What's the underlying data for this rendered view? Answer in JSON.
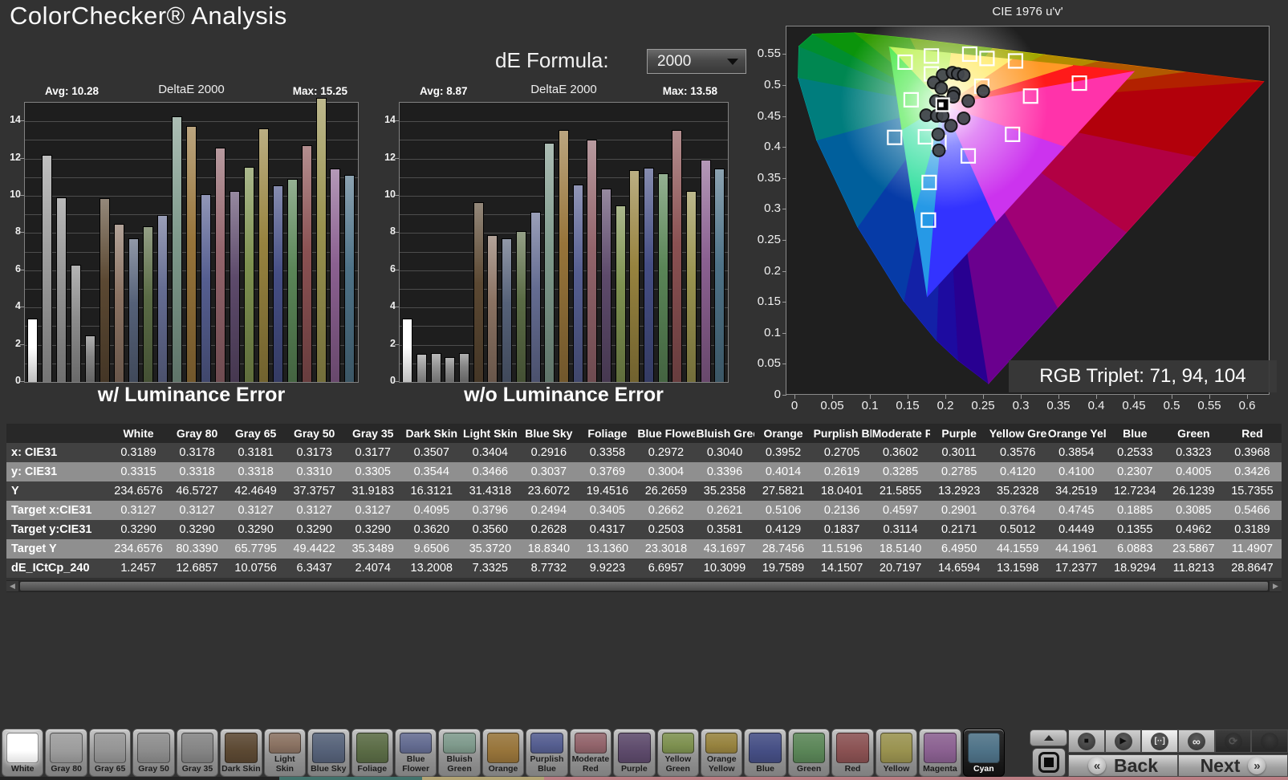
{
  "page": {
    "title": "ColorChecker® Analysis"
  },
  "de_formula": {
    "label": "dE Formula:",
    "value": "2000"
  },
  "chart_headers": {
    "left": {
      "avg": "Avg: 10.28",
      "formula": "DeltaE 2000",
      "max": "Max: 15.25",
      "caption": "w/ Luminance Error"
    },
    "right": {
      "avg": "Avg: 8.87",
      "formula": "DeltaE 2000",
      "max": "Max: 13.58",
      "caption": "w/o Luminance Error"
    }
  },
  "chart_data": [
    {
      "type": "bar",
      "title": "w/ Luminance Error",
      "subtitle": "DeltaE 2000",
      "avg": 10.28,
      "max": 15.25,
      "ylim": [
        0,
        15
      ],
      "yticks": [
        0,
        2,
        4,
        6,
        8,
        10,
        12,
        14
      ],
      "categories": [
        "White",
        "Gray 80",
        "Gray 65",
        "Gray 50",
        "Gray 35",
        "Dark Skin",
        "Light Skin",
        "Blue Sky",
        "Foliage",
        "Blue Flower",
        "Bluish Green",
        "Orange",
        "Purplish Blue",
        "Moderate Red",
        "Purple",
        "Yellow Green",
        "Orange Yellow",
        "Blue",
        "Green",
        "Red",
        "Yellow",
        "Magenta",
        "Cyan"
      ],
      "values": [
        3.4,
        12.2,
        9.9,
        6.3,
        2.5,
        9.85,
        8.5,
        7.7,
        8.35,
        8.95,
        14.25,
        13.75,
        10.1,
        12.6,
        10.25,
        11.55,
        13.6,
        10.55,
        10.9,
        12.7,
        15.25,
        11.45,
        11.1
      ]
    },
    {
      "type": "bar",
      "title": "w/o Luminance Error",
      "subtitle": "DeltaE 2000",
      "avg": 8.87,
      "max": 13.58,
      "ylim": [
        0,
        15
      ],
      "yticks": [
        0,
        2,
        4,
        6,
        8,
        10,
        12,
        14
      ],
      "categories": [
        "White",
        "Gray 80",
        "Gray 65",
        "Gray 50",
        "Gray 35",
        "Dark Skin",
        "Light Skin",
        "Blue Sky",
        "Foliage",
        "Blue Flower",
        "Bluish Green",
        "Orange",
        "Purplish Blue",
        "Moderate Red",
        "Purple",
        "Yellow Green",
        "Orange Yellow",
        "Blue",
        "Green",
        "Red",
        "Yellow",
        "Magenta",
        "Cyan"
      ],
      "values": [
        3.4,
        1.5,
        1.55,
        1.35,
        1.55,
        9.65,
        7.9,
        7.7,
        8.1,
        9.15,
        12.85,
        13.55,
        10.6,
        13.0,
        10.4,
        9.5,
        11.4,
        11.5,
        11.2,
        13.55,
        10.25,
        11.95,
        11.45
      ]
    },
    {
      "type": "scatter",
      "title": "CIE 1976 u'v'",
      "xlim": [
        0,
        0.63
      ],
      "ylim": [
        0,
        0.566
      ],
      "xticks": [
        "0",
        "0.05",
        "0.1",
        "0.15",
        "0.2",
        "0.25",
        "0.3",
        "0.35",
        "0.4",
        "0.45",
        "0.5",
        "0.55",
        "0.6"
      ],
      "yticks": [
        "0",
        "0.05",
        "0.1",
        "0.15",
        "0.2",
        "0.25",
        "0.3",
        "0.35",
        "0.4",
        "0.45",
        "0.5",
        "0.55"
      ],
      "annotation": "RGB Triplet: 71, 94, 104",
      "white_point": [
        0.196,
        0.469
      ],
      "series": [
        {
          "name": "reference-targets",
          "marker": "square",
          "points": [
            [
              0.146,
              0.538
            ],
            [
              0.181,
              0.548
            ],
            [
              0.232,
              0.551
            ],
            [
              0.255,
              0.544
            ],
            [
              0.293,
              0.54
            ],
            [
              0.378,
              0.504
            ],
            [
              0.248,
              0.499
            ],
            [
              0.313,
              0.483
            ],
            [
              0.154,
              0.477
            ],
            [
              0.181,
              0.519
            ],
            [
              0.132,
              0.416
            ],
            [
              0.173,
              0.417
            ],
            [
              0.191,
              0.408
            ],
            [
              0.289,
              0.421
            ],
            [
              0.23,
              0.386
            ],
            [
              0.178,
              0.343
            ],
            [
              0.177,
              0.282
            ]
          ]
        },
        {
          "name": "measured",
          "marker": "circle",
          "points": [
            [
              0.196,
              0.517
            ],
            [
              0.209,
              0.521
            ],
            [
              0.216,
              0.519
            ],
            [
              0.224,
              0.517
            ],
            [
              0.184,
              0.505
            ],
            [
              0.194,
              0.496
            ],
            [
              0.211,
              0.488
            ],
            [
              0.21,
              0.482
            ],
            [
              0.25,
              0.491
            ],
            [
              0.23,
              0.475
            ],
            [
              0.187,
              0.475
            ],
            [
              0.195,
              0.473
            ],
            [
              0.174,
              0.452
            ],
            [
              0.188,
              0.451
            ],
            [
              0.196,
              0.451
            ],
            [
              0.224,
              0.447
            ],
            [
              0.207,
              0.435
            ],
            [
              0.19,
              0.421
            ],
            [
              0.191,
              0.395
            ]
          ]
        }
      ]
    }
  ],
  "table": {
    "columns": [
      "White",
      "Gray 80",
      "Gray 65",
      "Gray 50",
      "Gray 35",
      "Dark Skin",
      "Light Skin",
      "Blue Sky",
      "Foliage",
      "Blue Flower",
      "Bluish Green",
      "Orange",
      "Purplish Blue",
      "Moderate Red",
      "Purple",
      "Yellow Green",
      "Orange Yellow",
      "Blue",
      "Green",
      "Red"
    ],
    "rows": [
      {
        "label": "x: CIE31",
        "values": [
          "0.3189",
          "0.3178",
          "0.3181",
          "0.3173",
          "0.3177",
          "0.3507",
          "0.3404",
          "0.2916",
          "0.3358",
          "0.2972",
          "0.3040",
          "0.3952",
          "0.2705",
          "0.3602",
          "0.3011",
          "0.3576",
          "0.3854",
          "0.2533",
          "0.3323",
          "0.3968"
        ]
      },
      {
        "label": "y: CIE31",
        "values": [
          "0.3315",
          "0.3318",
          "0.3318",
          "0.3310",
          "0.3305",
          "0.3544",
          "0.3466",
          "0.3037",
          "0.3769",
          "0.3004",
          "0.3396",
          "0.4014",
          "0.2619",
          "0.3285",
          "0.2785",
          "0.4120",
          "0.4100",
          "0.2307",
          "0.4005",
          "0.3426"
        ]
      },
      {
        "label": "Y",
        "values": [
          "234.6576",
          "46.5727",
          "42.4649",
          "37.3757",
          "31.9183",
          "16.3121",
          "31.4318",
          "23.6072",
          "19.4516",
          "26.2659",
          "35.2358",
          "27.5821",
          "18.0401",
          "21.5855",
          "13.2923",
          "35.2328",
          "34.2519",
          "12.7234",
          "26.1239",
          "15.7355"
        ]
      },
      {
        "label": "Target x:CIE31",
        "values": [
          "0.3127",
          "0.3127",
          "0.3127",
          "0.3127",
          "0.3127",
          "0.4095",
          "0.3796",
          "0.2494",
          "0.3405",
          "0.2662",
          "0.2621",
          "0.5106",
          "0.2136",
          "0.4597",
          "0.2901",
          "0.3764",
          "0.4745",
          "0.1885",
          "0.3085",
          "0.5466"
        ]
      },
      {
        "label": "Target y:CIE31",
        "values": [
          "0.3290",
          "0.3290",
          "0.3290",
          "0.3290",
          "0.3290",
          "0.3620",
          "0.3560",
          "0.2628",
          "0.4317",
          "0.2503",
          "0.3581",
          "0.4129",
          "0.1837",
          "0.3114",
          "0.2171",
          "0.5012",
          "0.4449",
          "0.1355",
          "0.4962",
          "0.3189"
        ]
      },
      {
        "label": "Target Y",
        "values": [
          "234.6576",
          "80.3390",
          "65.7795",
          "49.4422",
          "35.3489",
          "9.6506",
          "35.3720",
          "18.8340",
          "13.1360",
          "23.3018",
          "43.1697",
          "28.7456",
          "11.5196",
          "18.5140",
          "6.4950",
          "44.1559",
          "44.1961",
          "6.0883",
          "23.5867",
          "11.4907"
        ]
      },
      {
        "label": "dE_ICtCp_240",
        "values": [
          "1.2457",
          "12.6857",
          "10.0756",
          "6.3437",
          "2.4074",
          "13.2008",
          "7.3325",
          "8.7732",
          "9.9223",
          "6.6957",
          "10.3099",
          "19.7589",
          "14.1507",
          "20.7197",
          "14.6594",
          "13.1598",
          "17.2377",
          "18.9294",
          "11.8213",
          "28.8647"
        ]
      }
    ]
  },
  "swatches": {
    "items": [
      {
        "label": "White",
        "color": "#ffffff",
        "selected": false
      },
      {
        "label": "Gray 80",
        "color": "#9c9c9c",
        "selected": false
      },
      {
        "label": "Gray 65",
        "color": "#949494",
        "selected": false
      },
      {
        "label": "Gray 50",
        "color": "#8c8c8c",
        "selected": false
      },
      {
        "label": "Gray 35",
        "color": "#848484",
        "selected": false
      },
      {
        "label": "Dark Skin",
        "color": "#5b4832",
        "selected": false
      },
      {
        "label": "Light Skin",
        "color": "#8a7262",
        "selected": false
      },
      {
        "label": "Blue Sky",
        "color": "#556178",
        "selected": false
      },
      {
        "label": "Foliage",
        "color": "#5a6b45",
        "selected": false
      },
      {
        "label": "Blue\nFlower",
        "color": "#646c91",
        "selected": false
      },
      {
        "label": "Bluish\nGreen",
        "color": "#7f9a8c",
        "selected": false
      },
      {
        "label": "Orange",
        "color": "#97743a",
        "selected": false
      },
      {
        "label": "Purplish\nBlue",
        "color": "#555e90",
        "selected": false
      },
      {
        "label": "Moderate\nRed",
        "color": "#92646b",
        "selected": false
      },
      {
        "label": "Purple",
        "color": "#5d4a6b",
        "selected": false
      },
      {
        "label": "Yellow\nGreen",
        "color": "#7e9150",
        "selected": false
      },
      {
        "label": "Orange\nYellow",
        "color": "#97833f",
        "selected": false
      },
      {
        "label": "Blue",
        "color": "#454e84",
        "selected": false
      },
      {
        "label": "Green",
        "color": "#5a8557",
        "selected": false
      },
      {
        "label": "Red",
        "color": "#8a5152",
        "selected": false
      },
      {
        "label": "Yellow",
        "color": "#99924f",
        "selected": false
      },
      {
        "label": "Magenta",
        "color": "#8a6090",
        "selected": false
      },
      {
        "label": "Cyan",
        "color": "#4e7287",
        "selected": true
      }
    ]
  },
  "controls": {
    "back_label": "Back",
    "next_label": "Next",
    "back_icon": "«",
    "next_icon": "»",
    "transport": [
      {
        "name": "stop-button",
        "glyph": "■",
        "style": "lite"
      },
      {
        "name": "play-button",
        "glyph": "▶",
        "style": "lite"
      },
      {
        "name": "single-step-button",
        "glyph": "[··]",
        "style": "bright"
      },
      {
        "name": "loop-button",
        "glyph": "∞",
        "style": "lite"
      },
      {
        "name": "refresh-button",
        "glyph": "⟳",
        "style": "darkb"
      },
      {
        "name": "record-button",
        "glyph": "",
        "style": "darkb"
      }
    ]
  }
}
